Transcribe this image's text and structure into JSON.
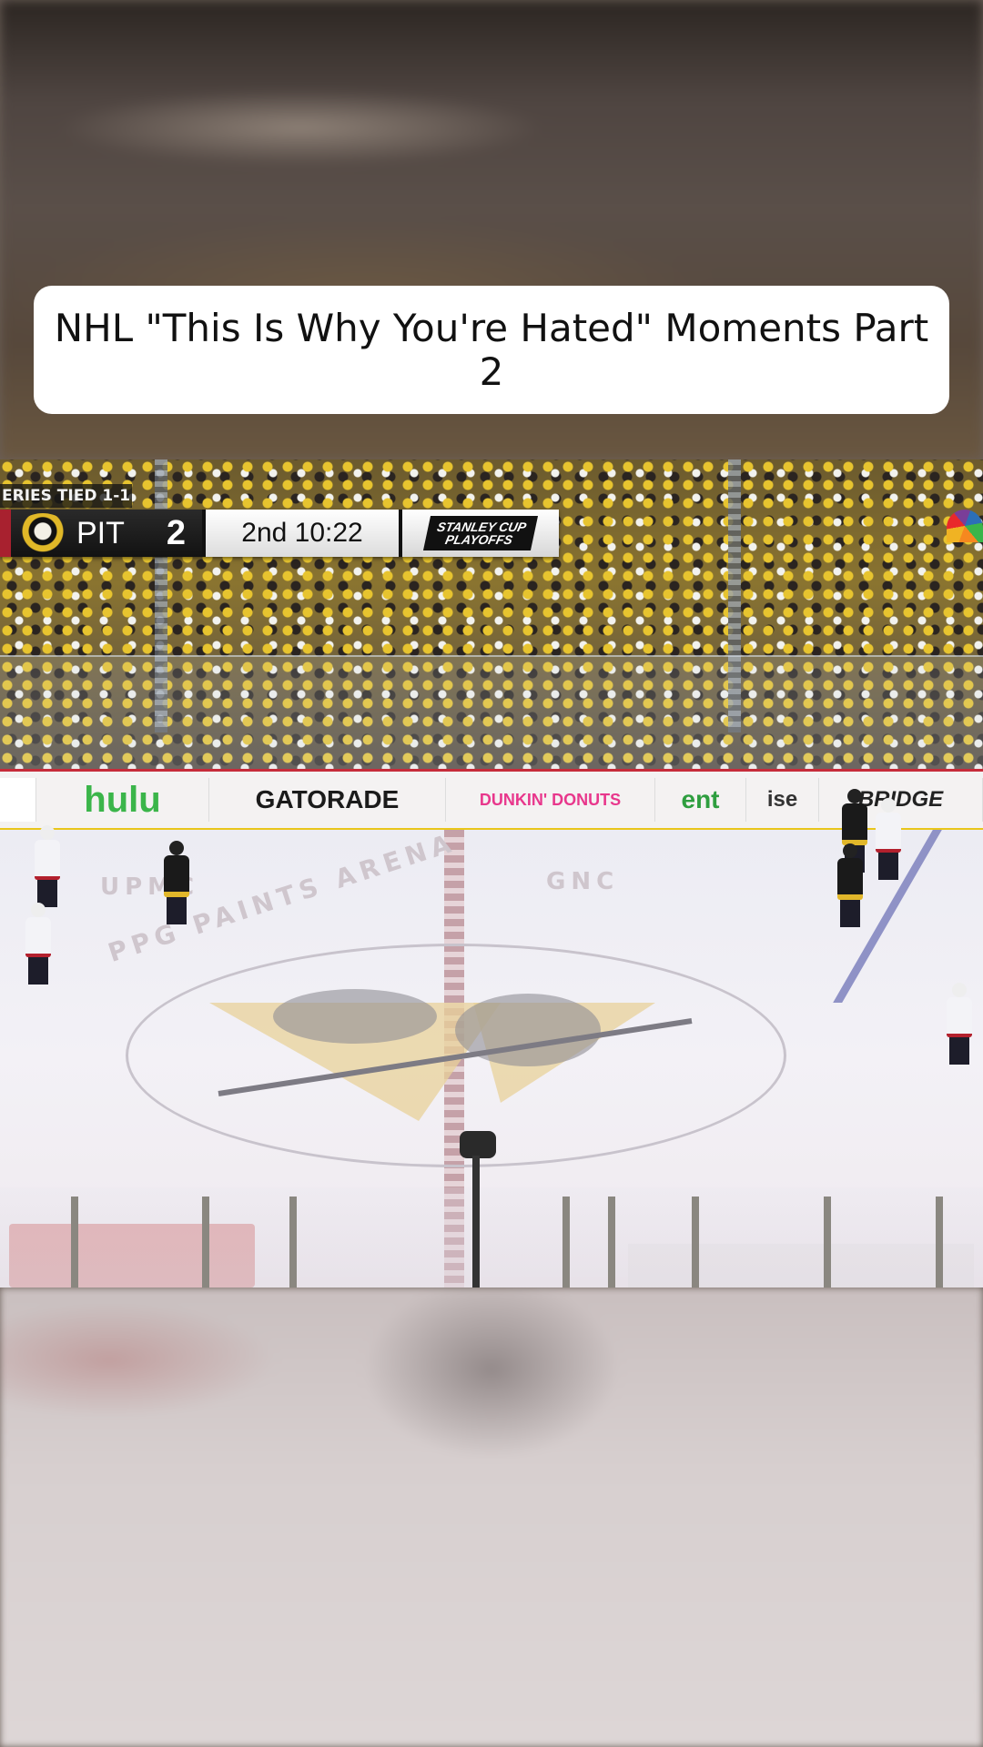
{
  "title_card": {
    "text": "NHL \"This Is Why You're Hated\" Moments Part 2"
  },
  "broadcast": {
    "series_status": "ERIES TIED 1-1",
    "team_abbr": "PIT",
    "team_score": "2",
    "period_clock": "2nd 10:22",
    "event_badge_line1": "STANLEY CUP",
    "event_badge_line2": "PLAYOFFS",
    "team_logo": "penguins-logo-icon",
    "network_logo": "peacock-icon"
  },
  "ads": [
    {
      "label": "hulu",
      "color": "#3bb54a"
    },
    {
      "label": "GATORADE",
      "color": "#1b1b1b"
    },
    {
      "label": "DUNKIN' DONUTS",
      "color": "#e8378c"
    },
    {
      "label": "ent",
      "color": "#2e9e3f"
    },
    {
      "label": "ise",
      "color": "#333333"
    },
    {
      "label": "BRIDGE",
      "color": "#222222"
    }
  ],
  "ice_markings": {
    "arena_text_top": "PPG PAINTS ARENA",
    "ad_left": "UPMC",
    "ad_right": "GNC"
  },
  "colors": {
    "home_jersey": "#1a1a1a",
    "home_accent": "#e1b72a",
    "away_jersey": "#f3f3f7",
    "away_accent": "#b3202d"
  }
}
